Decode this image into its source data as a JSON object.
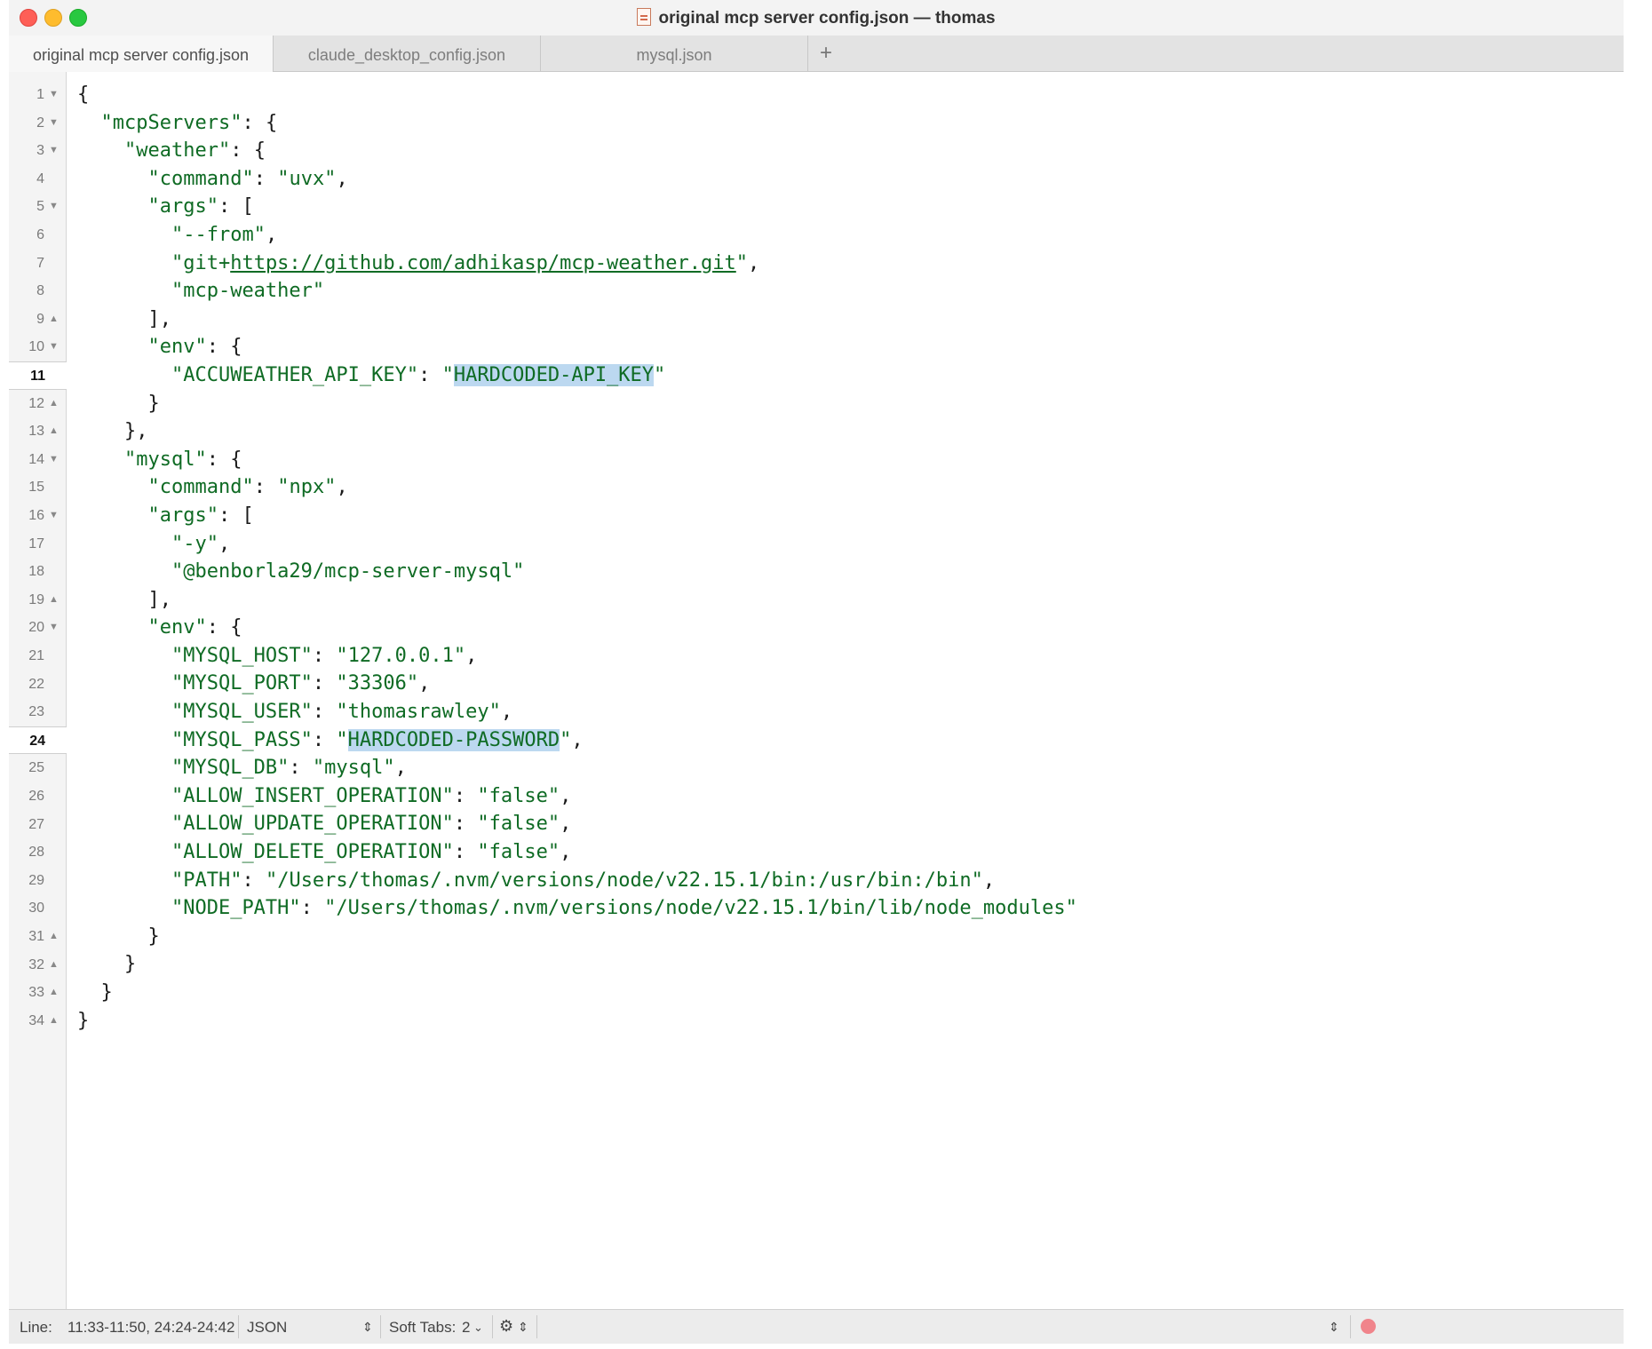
{
  "window": {
    "title": "original mcp server config.json — thomas"
  },
  "tabs": [
    {
      "label": "original mcp server config.json",
      "active": true
    },
    {
      "label": "claude_desktop_config.json",
      "active": false
    },
    {
      "label": "mysql.json",
      "active": false
    }
  ],
  "tab_add_label": "+",
  "editor": {
    "line_numbers": [
      "1",
      "2",
      "3",
      "4",
      "5",
      "6",
      "7",
      "8",
      "9",
      "10",
      "11",
      "12",
      "13",
      "14",
      "15",
      "16",
      "17",
      "18",
      "19",
      "20",
      "21",
      "22",
      "23",
      "24",
      "25",
      "26",
      "27",
      "28",
      "29",
      "30",
      "31",
      "32",
      "33",
      "34"
    ],
    "current_lines": [
      "11",
      "24"
    ],
    "code": {
      "mcpServers_key": "\"mcpServers\"",
      "weather_key": "\"weather\"",
      "weather_command_key": "\"command\"",
      "weather_command_val": "\"uvx\"",
      "weather_args_key": "\"args\"",
      "weather_arg1": "\"--from\"",
      "weather_arg2_prefix": "\"git+",
      "weather_arg2_url": "https://github.com/adhikasp/mcp-weather.git",
      "weather_arg2_suffix": "\"",
      "weather_arg3": "\"mcp-weather\"",
      "weather_env_key": "\"env\"",
      "accuweather_key": "\"ACCUWEATHER_API_KEY\"",
      "accuweather_val": "HARDCODED-API_KEY",
      "mysql_key": "\"mysql\"",
      "mysql_command_key": "\"command\"",
      "mysql_command_val": "\"npx\"",
      "mysql_args_key": "\"args\"",
      "mysql_arg1": "\"-y\"",
      "mysql_arg2": "\"@benborla29/mcp-server-mysql\"",
      "mysql_env_key": "\"env\"",
      "env_host_key": "\"MYSQL_HOST\"",
      "env_host_val": "\"127.0.0.1\"",
      "env_port_key": "\"MYSQL_PORT\"",
      "env_port_val": "\"33306\"",
      "env_user_key": "\"MYSQL_USER\"",
      "env_user_val": "\"thomasrawley\"",
      "env_pass_key": "\"MYSQL_PASS\"",
      "env_pass_val": "HARDCODED-PASSWORD",
      "env_db_key": "\"MYSQL_DB\"",
      "env_db_val": "\"mysql\"",
      "env_insert_key": "\"ALLOW_INSERT_OPERATION\"",
      "env_insert_val": "\"false\"",
      "env_update_key": "\"ALLOW_UPDATE_OPERATION\"",
      "env_update_val": "\"false\"",
      "env_delete_key": "\"ALLOW_DELETE_OPERATION\"",
      "env_delete_val": "\"false\"",
      "env_path_key": "\"PATH\"",
      "env_path_val": "\"/Users/thomas/.nvm/versions/node/v22.15.1/bin:/usr/bin:/bin\"",
      "env_nodepath_key": "\"NODE_PATH\"",
      "env_nodepath_val": "\"/Users/thomas/.nvm/versions/node/v22.15.1/bin/lib/node_modules\""
    }
  },
  "statusbar": {
    "line_label": "Line:",
    "line_value": "11:33-11:50, 24:24-24:42",
    "language": "JSON",
    "soft_tabs_label": "Soft Tabs:",
    "soft_tabs_value": "2"
  },
  "colors": {
    "string": "#0f6b24",
    "selection": "#bcd8f0",
    "close": "#fe5f57",
    "minimize": "#febc2e",
    "maximize": "#28c840"
  }
}
